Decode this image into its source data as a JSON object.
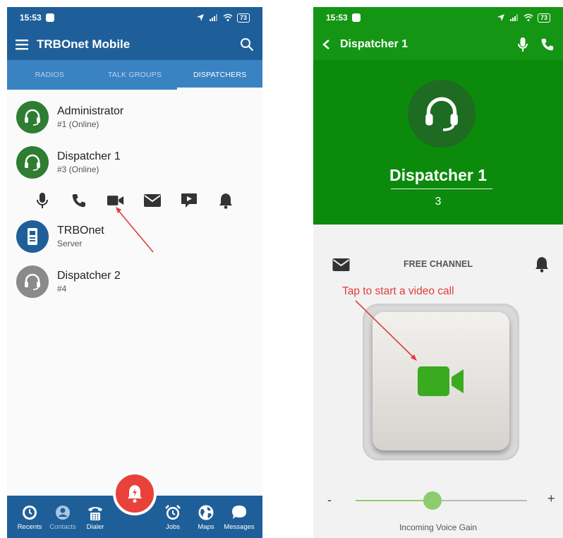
{
  "left": {
    "status": {
      "time": "15:53",
      "battery": "73"
    },
    "appbar": {
      "title": "TRBOnet Mobile"
    },
    "tabs": [
      "RADIOS",
      "TALK GROUPS",
      "DISPATCHERS"
    ],
    "active_tab": "DISPATCHERS",
    "contacts": [
      {
        "name": "Administrator",
        "sub": "#1 (Online)",
        "color": "#2e7d32"
      },
      {
        "name": "Dispatcher 1",
        "sub": "#3 (Online)",
        "color": "#2e7d32"
      },
      {
        "name": "TRBOnet",
        "sub": "Server",
        "color": "#1f5f99"
      },
      {
        "name": "Dispatcher 2",
        "sub": "#4",
        "color": "#8a8a8a"
      }
    ],
    "actions": [
      "mic-icon",
      "phone-icon",
      "video-icon",
      "mail-icon",
      "message-icon",
      "bell-icon"
    ],
    "nav": [
      {
        "label": "Recents"
      },
      {
        "label": "Contacts"
      },
      {
        "label": "Dialer"
      },
      {
        "label": "Jobs"
      },
      {
        "label": "Maps"
      },
      {
        "label": "Messages"
      }
    ]
  },
  "right": {
    "status": {
      "time": "15:53",
      "battery": "73"
    },
    "appbar": {
      "title": "Dispatcher 1"
    },
    "dispatcher_name": "Dispatcher 1",
    "dispatcher_number": "3",
    "channel_status": "FREE CHANNEL",
    "hint": "Tap to start a video call",
    "slider": {
      "minus": "-",
      "plus": "+",
      "label": "Incoming Voice Gain",
      "value_fraction": 0.45
    }
  },
  "colors": {
    "left_primary": "#1f5f99",
    "left_tabs": "#3a83c3",
    "right_primary": "#149614",
    "right_header": "#0b8a0b",
    "alert": "#e8423b",
    "video_green": "#3aaa1f",
    "annotation_red": "#e23d3d"
  }
}
